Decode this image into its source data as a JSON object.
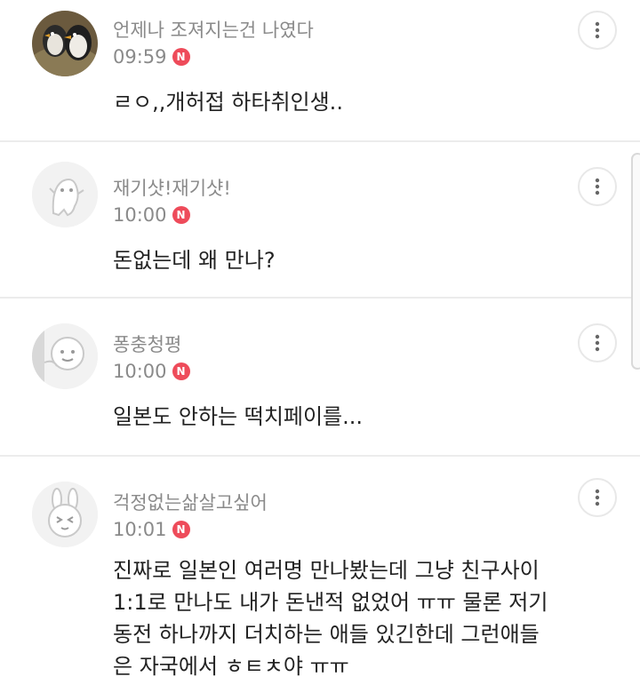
{
  "comments": [
    {
      "nickname": "언제나 조져지는건 나였다",
      "time": "09:59",
      "new_badge": "N",
      "text": "ㄹㅇ,,개허접 하타취인생..",
      "avatar": "penguins-photo-avatar"
    },
    {
      "nickname": "재기샷!재기샷!",
      "time": "10:00",
      "new_badge": "N",
      "text": "돈없는데 왜 만나?",
      "avatar": "default-ghost-avatar"
    },
    {
      "nickname": "퐁충청평",
      "time": "10:00",
      "new_badge": "N",
      "text": "일본도 안하는 떡치페이를...",
      "avatar": "default-peeking-avatar"
    },
    {
      "nickname": "걱정없는삶살고싶어",
      "time": "10:01",
      "new_badge": "N",
      "text_lines": [
        "진짜로 일본인 여러명 만나봤는데 그냥 친구사이",
        "1:1로 만나도 내가 돈낸적 없었어 ㅠㅠ 물론 저기",
        "동전 하나까지 더치하는 애들 있긴한데 그런애들",
        "은 자국에서 ㅎㅌㅊ야 ㅠㅠ"
      ],
      "avatar": "default-rabbit-avatar"
    }
  ],
  "colors": {
    "badge": "#ee4b5a",
    "meta_text": "#8a8a8a",
    "body_text": "#222222",
    "divider": "#ececec"
  },
  "icons": {
    "more": "more-vertical-icon"
  }
}
